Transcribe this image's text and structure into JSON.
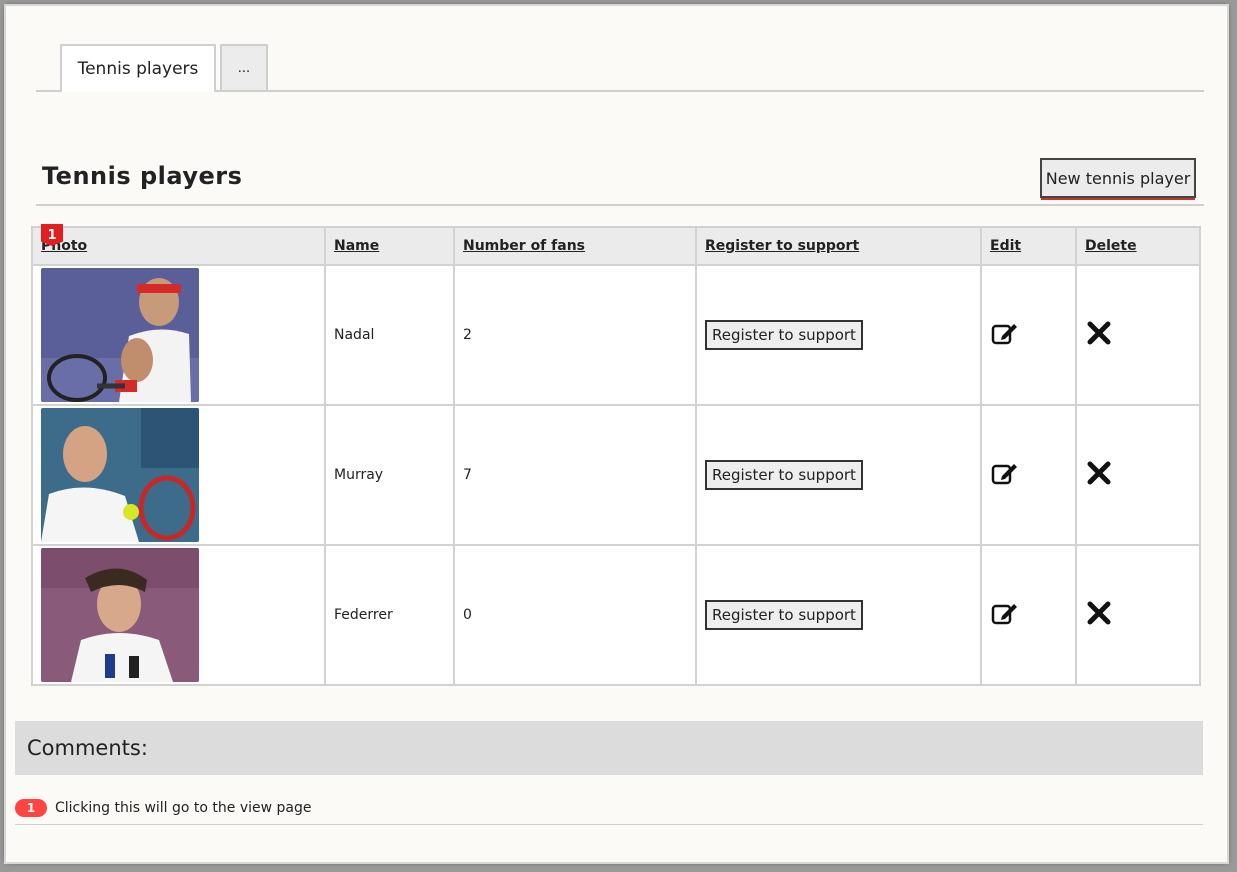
{
  "tabs": [
    {
      "label": "Tennis players",
      "active": true
    },
    {
      "label": "...",
      "active": false
    }
  ],
  "page": {
    "title": "Tennis players",
    "new_button": "New tennis player"
  },
  "table": {
    "headers": [
      "Photo",
      "Name",
      "Number of fans",
      "Register to support",
      "Edit",
      "Delete"
    ],
    "photo_marker": "1",
    "rows": [
      {
        "name": "Nadal",
        "fans": "2",
        "register": "Register to support",
        "photo_icon": "player-photo-nadal"
      },
      {
        "name": "Murray",
        "fans": "7",
        "register": "Register to support",
        "photo_icon": "player-photo-murray"
      },
      {
        "name": "Federrer",
        "fans": "0",
        "register": "Register to support",
        "photo_icon": "player-photo-federer"
      }
    ]
  },
  "comments": {
    "heading": "Comments:",
    "items": [
      {
        "number": "1",
        "text": "Clicking this will go to the view page"
      }
    ]
  },
  "colors": {
    "marker": "#e02020",
    "comment_badge": "#ff4444",
    "accent_underline": "#c0392b"
  }
}
